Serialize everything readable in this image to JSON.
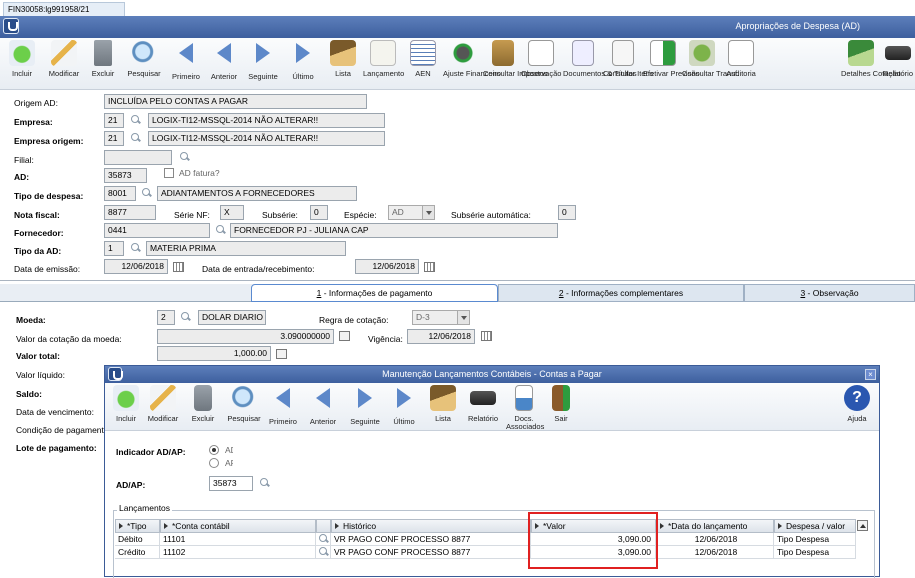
{
  "window_tab": "FIN30058:lg991958/21",
  "title": "Apropriações de Despesa (AD)",
  "toolbar": [
    {
      "label": "Incluir",
      "u": "I",
      "icon": "add-icon"
    },
    {
      "label": "Modificar",
      "icon": "edit-icon"
    },
    {
      "label": "Excluir",
      "icon": "trash-icon"
    },
    {
      "label": "Pesquisar",
      "icon": "search-icon"
    },
    {
      "label": "Primeiro",
      "icon": "first-icon"
    },
    {
      "label": "Anterior",
      "icon": "previous-icon"
    },
    {
      "label": "Seguinte",
      "icon": "next-icon"
    },
    {
      "label": "Último",
      "icon": "last-icon"
    },
    {
      "label": "Lista",
      "icon": "list-icon"
    },
    {
      "label": "Lançamento",
      "icon": "posting-icon"
    },
    {
      "label": "AEN",
      "icon": "aen-icon"
    },
    {
      "label": "Ajuste Financeiro",
      "icon": "adjust-icon"
    },
    {
      "label": "Consultar Impostos",
      "icon": "taxes-icon"
    },
    {
      "label": "Observação",
      "icon": "note-icon"
    },
    {
      "label": "Documentos & Títulos",
      "icon": "documents-icon"
    },
    {
      "label": "Consultar Itens",
      "icon": "items-icon"
    },
    {
      "label": "Efetivar Previsão",
      "icon": "forecast-icon"
    },
    {
      "label": "Consultar Transf.",
      "icon": "transfer-icon"
    },
    {
      "label": "Auditoria",
      "icon": "audit-icon"
    },
    {
      "label": "Detalhes Cotação",
      "icon": "quote-icon"
    },
    {
      "label": "Relatório",
      "icon": "printer-icon"
    }
  ],
  "form": {
    "origem_label": "Origem AD:",
    "origem_value": "INCLUÍDA PELO CONTAS A PAGAR",
    "empresa_label": "Empresa:",
    "empresa_code": "21",
    "empresa_name": "LOGIX-TI12-MSSQL-2014 NÃO ALTERAR!!",
    "empresa_origem_label": "Empresa origem:",
    "empresa_origem_code": "21",
    "empresa_origem_name": "LOGIX-TI12-MSSQL-2014 NÃO ALTERAR!!",
    "filial_label": "Filial:",
    "ad_label": "AD:",
    "ad_value": "35873",
    "ad_fatura_label": "AD fatura?",
    "tipo_despesa_label": "Tipo de despesa:",
    "tipo_despesa_code": "8001",
    "tipo_despesa_name": "ADIANTAMENTOS A FORNECEDORES",
    "nota_fiscal_label": "Nota fiscal:",
    "nota_fiscal_value": "8877",
    "serie_label": "Série NF:",
    "serie_value": "X",
    "subserie_label": "Subsérie:",
    "subserie_value": "0",
    "especie_label": "Espécie:",
    "especie_value": "AD",
    "subserie_auto_label": "Subsérie automática:",
    "subserie_auto_value": "0",
    "fornecedor_label": "Fornecedor:",
    "fornecedor_code": "0441",
    "fornecedor_name": "FORNECEDOR PJ - JULIANA CAP",
    "tipo_ad_label": "Tipo da AD:",
    "tipo_ad_code": "1",
    "tipo_ad_name": "MATERIA PRIMA",
    "data_emissao_label": "Data de emissão:",
    "data_emissao_value": "12/06/2018",
    "data_entrada_label": "Data de entrada/recebimento:",
    "data_entrada_value": "12/06/2018"
  },
  "tabs": [
    {
      "num": "1",
      "label": " - Informações de pagamento",
      "active": true
    },
    {
      "num": "2",
      "label": " - Informações complementares",
      "active": false
    },
    {
      "num": "3",
      "label": " - Observação",
      "active": false
    }
  ],
  "payment": {
    "moeda_label": "Moeda:",
    "moeda_code": "2",
    "moeda_name": "DOLAR DIARIO",
    "regra_label": "Regra de cotação:",
    "regra_value": "D-3",
    "valor_cotacao_label": "Valor da cotação da moeda:",
    "valor_cotacao_value": "3.090000000",
    "vigencia_label": "Vigência:",
    "vigencia_value": "12/06/2018",
    "valor_total_label": "Valor total:",
    "valor_total_value": "1,000.00",
    "valor_liquido_label": "Valor líquido:",
    "saldo_label": "Saldo:",
    "data_vencimento_label": "Data de vencimento:",
    "condicao_label": "Condição de pagament",
    "lote_label": "Lote de pagamento:"
  },
  "dialog": {
    "title": "Manutenção Lançamentos Contábeis - Contas a Pagar",
    "close": "×",
    "toolbar": [
      {
        "label": "Incluir",
        "icon": "add-icon"
      },
      {
        "label": "Modificar",
        "icon": "edit-icon"
      },
      {
        "label": "Excluir",
        "icon": "trash-icon"
      },
      {
        "label": "Pesquisar",
        "icon": "search-icon"
      },
      {
        "label": "Primeiro",
        "icon": "first-icon"
      },
      {
        "label": "Anterior",
        "icon": "previous-icon"
      },
      {
        "label": "Seguinte",
        "icon": "next-icon"
      },
      {
        "label": "Último",
        "icon": "last-icon"
      },
      {
        "label": "Lista",
        "icon": "list-icon"
      },
      {
        "label": "Relatório",
        "icon": "printer-icon"
      },
      {
        "label": "Docs. Associados",
        "icon": "docs-icon"
      },
      {
        "label": "Sair",
        "icon": "exit-icon"
      },
      {
        "label": "Ajuda",
        "icon": "help-icon"
      }
    ],
    "indicador_label": "Indicador AD/AP:",
    "opt_ad": "AD",
    "opt_ap": "AP",
    "adap_label": "AD/AP:",
    "adap_value": "35873",
    "group_label": "Lançamentos",
    "columns": [
      "*Tipo",
      "*Conta contábil",
      "Histórico",
      "*Valor",
      "*Data do lançamento",
      "Despesa / valor"
    ],
    "rows": [
      {
        "tipo": "Débito",
        "conta": "11101",
        "historico": "VR PAGO CONF PROCESSO 8877",
        "valor": "3,090.00",
        "data": "12/06/2018",
        "despesa": "Tipo Despesa"
      },
      {
        "tipo": "Crédito",
        "conta": "11102",
        "historico": "VR PAGO CONF PROCESSO 8877",
        "valor": "3,090.00",
        "data": "12/06/2018",
        "despesa": "Tipo Despesa"
      }
    ]
  },
  "colors": {
    "titlebar": "#3d5f9e",
    "highlight": "#e02020",
    "accent": "#5d88c9"
  }
}
